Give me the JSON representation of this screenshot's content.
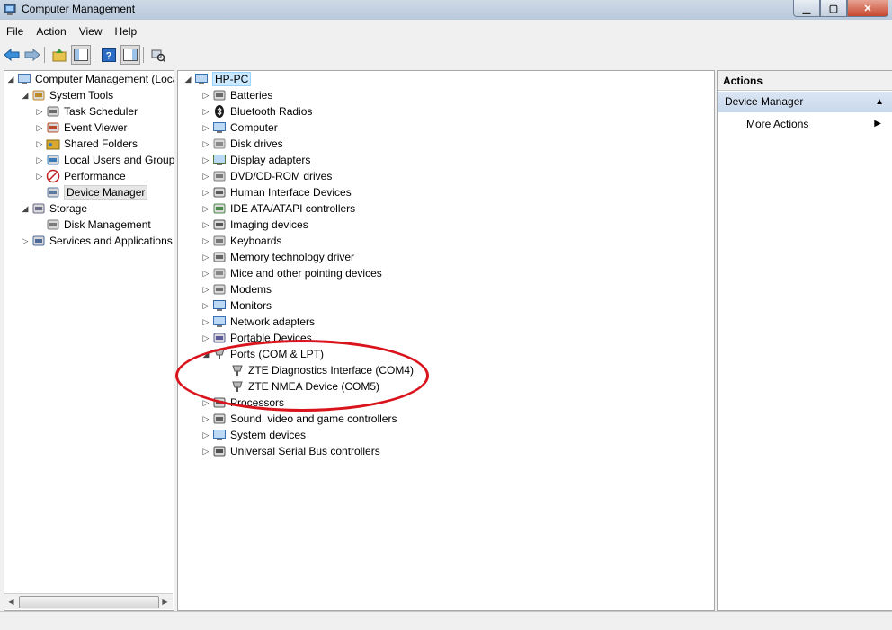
{
  "window": {
    "title": "Computer Management"
  },
  "menu": [
    "File",
    "Action",
    "View",
    "Help"
  ],
  "left_tree": [
    {
      "label": "Computer Management (Local",
      "arrow": "◢",
      "icon": "computer-management-icon",
      "level": 0
    },
    {
      "label": "System Tools",
      "arrow": "◢",
      "icon": "system-tools-icon",
      "level": 1
    },
    {
      "label": "Task Scheduler",
      "arrow": "▷",
      "icon": "task-scheduler-icon",
      "level": 2
    },
    {
      "label": "Event Viewer",
      "arrow": "▷",
      "icon": "event-viewer-icon",
      "level": 2
    },
    {
      "label": "Shared Folders",
      "arrow": "▷",
      "icon": "shared-folders-icon",
      "level": 2
    },
    {
      "label": "Local Users and Groups",
      "arrow": "▷",
      "icon": "users-groups-icon",
      "level": 2
    },
    {
      "label": "Performance",
      "arrow": "▷",
      "icon": "performance-icon",
      "level": 2
    },
    {
      "label": "Device Manager",
      "arrow": "",
      "icon": "device-manager-icon",
      "level": 2,
      "selected": true
    },
    {
      "label": "Storage",
      "arrow": "◢",
      "icon": "storage-icon",
      "level": 1
    },
    {
      "label": "Disk Management",
      "arrow": "",
      "icon": "disk-management-icon",
      "level": 2
    },
    {
      "label": "Services and Applications",
      "arrow": "▷",
      "icon": "services-icon",
      "level": 1
    }
  ],
  "device_tree": {
    "root": "HP-PC",
    "categories": [
      {
        "label": "Batteries",
        "icon": "battery-icon"
      },
      {
        "label": "Bluetooth Radios",
        "icon": "bluetooth-icon"
      },
      {
        "label": "Computer",
        "icon": "computer-icon"
      },
      {
        "label": "Disk drives",
        "icon": "disk-drive-icon"
      },
      {
        "label": "Display adapters",
        "icon": "display-adapter-icon"
      },
      {
        "label": "DVD/CD-ROM drives",
        "icon": "dvd-drive-icon"
      },
      {
        "label": "Human Interface Devices",
        "icon": "hid-icon"
      },
      {
        "label": "IDE ATA/ATAPI controllers",
        "icon": "ide-controller-icon"
      },
      {
        "label": "Imaging devices",
        "icon": "camera-icon"
      },
      {
        "label": "Keyboards",
        "icon": "keyboard-icon"
      },
      {
        "label": "Memory technology driver",
        "icon": "memory-icon"
      },
      {
        "label": "Mice and other pointing devices",
        "icon": "mouse-icon"
      },
      {
        "label": "Modems",
        "icon": "modem-icon"
      },
      {
        "label": "Monitors",
        "icon": "monitor-icon"
      },
      {
        "label": "Network adapters",
        "icon": "network-adapter-icon"
      },
      {
        "label": "Portable Devices",
        "icon": "portable-device-icon"
      },
      {
        "label": "Ports (COM & LPT)",
        "icon": "port-icon",
        "expanded": true,
        "children": [
          {
            "label": "ZTE Diagnostics Interface (COM4)",
            "icon": "port-icon"
          },
          {
            "label": "ZTE NMEA Device (COM5)",
            "icon": "port-icon"
          }
        ]
      },
      {
        "label": "Processors",
        "icon": "processor-icon"
      },
      {
        "label": "Sound, video and game controllers",
        "icon": "sound-icon"
      },
      {
        "label": "System devices",
        "icon": "system-device-icon"
      },
      {
        "label": "Universal Serial Bus controllers",
        "icon": "usb-icon"
      }
    ]
  },
  "actions": {
    "header": "Actions",
    "section": "Device Manager",
    "more": "More Actions"
  },
  "colors": {
    "annotation": "#d9141c",
    "selected_root_bg": "#cce8ff"
  }
}
